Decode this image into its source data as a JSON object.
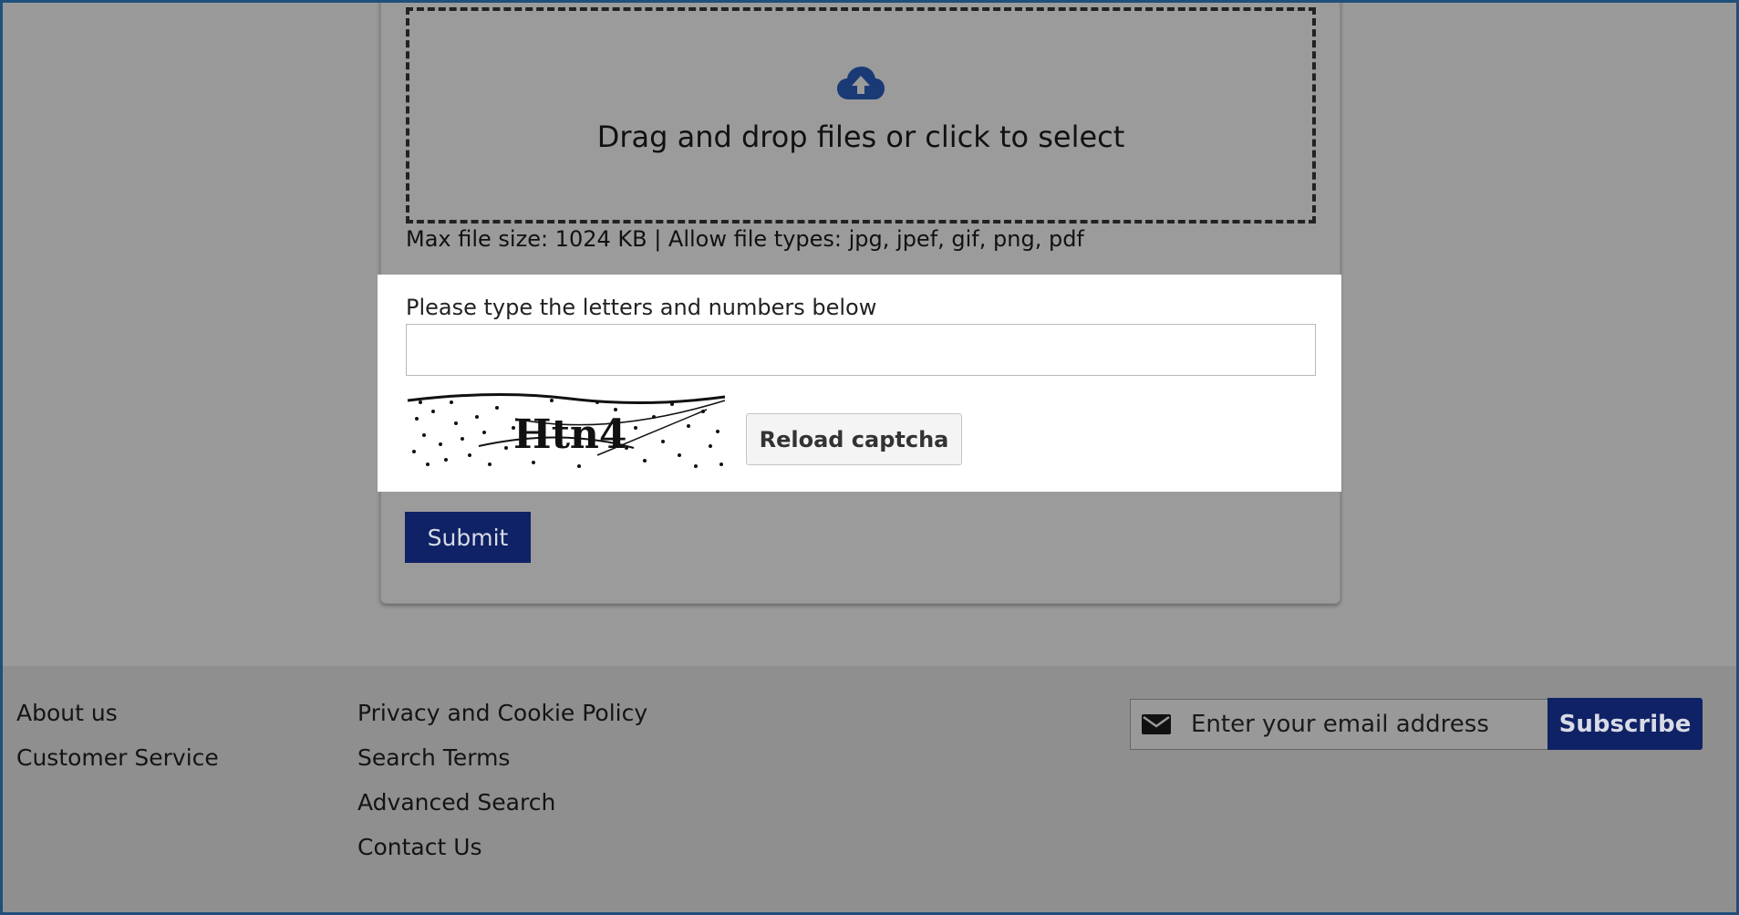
{
  "upload": {
    "icon": "cloud-upload-icon",
    "dropzone_text": "Drag and drop files or click to select",
    "file_info": "Max file size: 1024 KB | Allow file types: jpg, jpef, gif, png, pdf"
  },
  "captcha": {
    "label": "Please type the letters and numbers below",
    "input_value": "",
    "image_text": "Htn4",
    "reload_label": "Reload captcha"
  },
  "form": {
    "submit_label": "Submit"
  },
  "footer": {
    "column1": [
      "About us",
      "Customer Service"
    ],
    "column2": [
      "Privacy and Cookie Policy",
      "Search Terms",
      "Advanced Search",
      "Contact Us"
    ],
    "newsletter": {
      "icon": "envelope-icon",
      "placeholder": "Enter your email address",
      "subscribe_label": "Subscribe"
    }
  },
  "colors": {
    "brand_navy": "#0f2265",
    "overlay_gray": "#9a9a9a",
    "upload_icon": "#1a3a75"
  }
}
